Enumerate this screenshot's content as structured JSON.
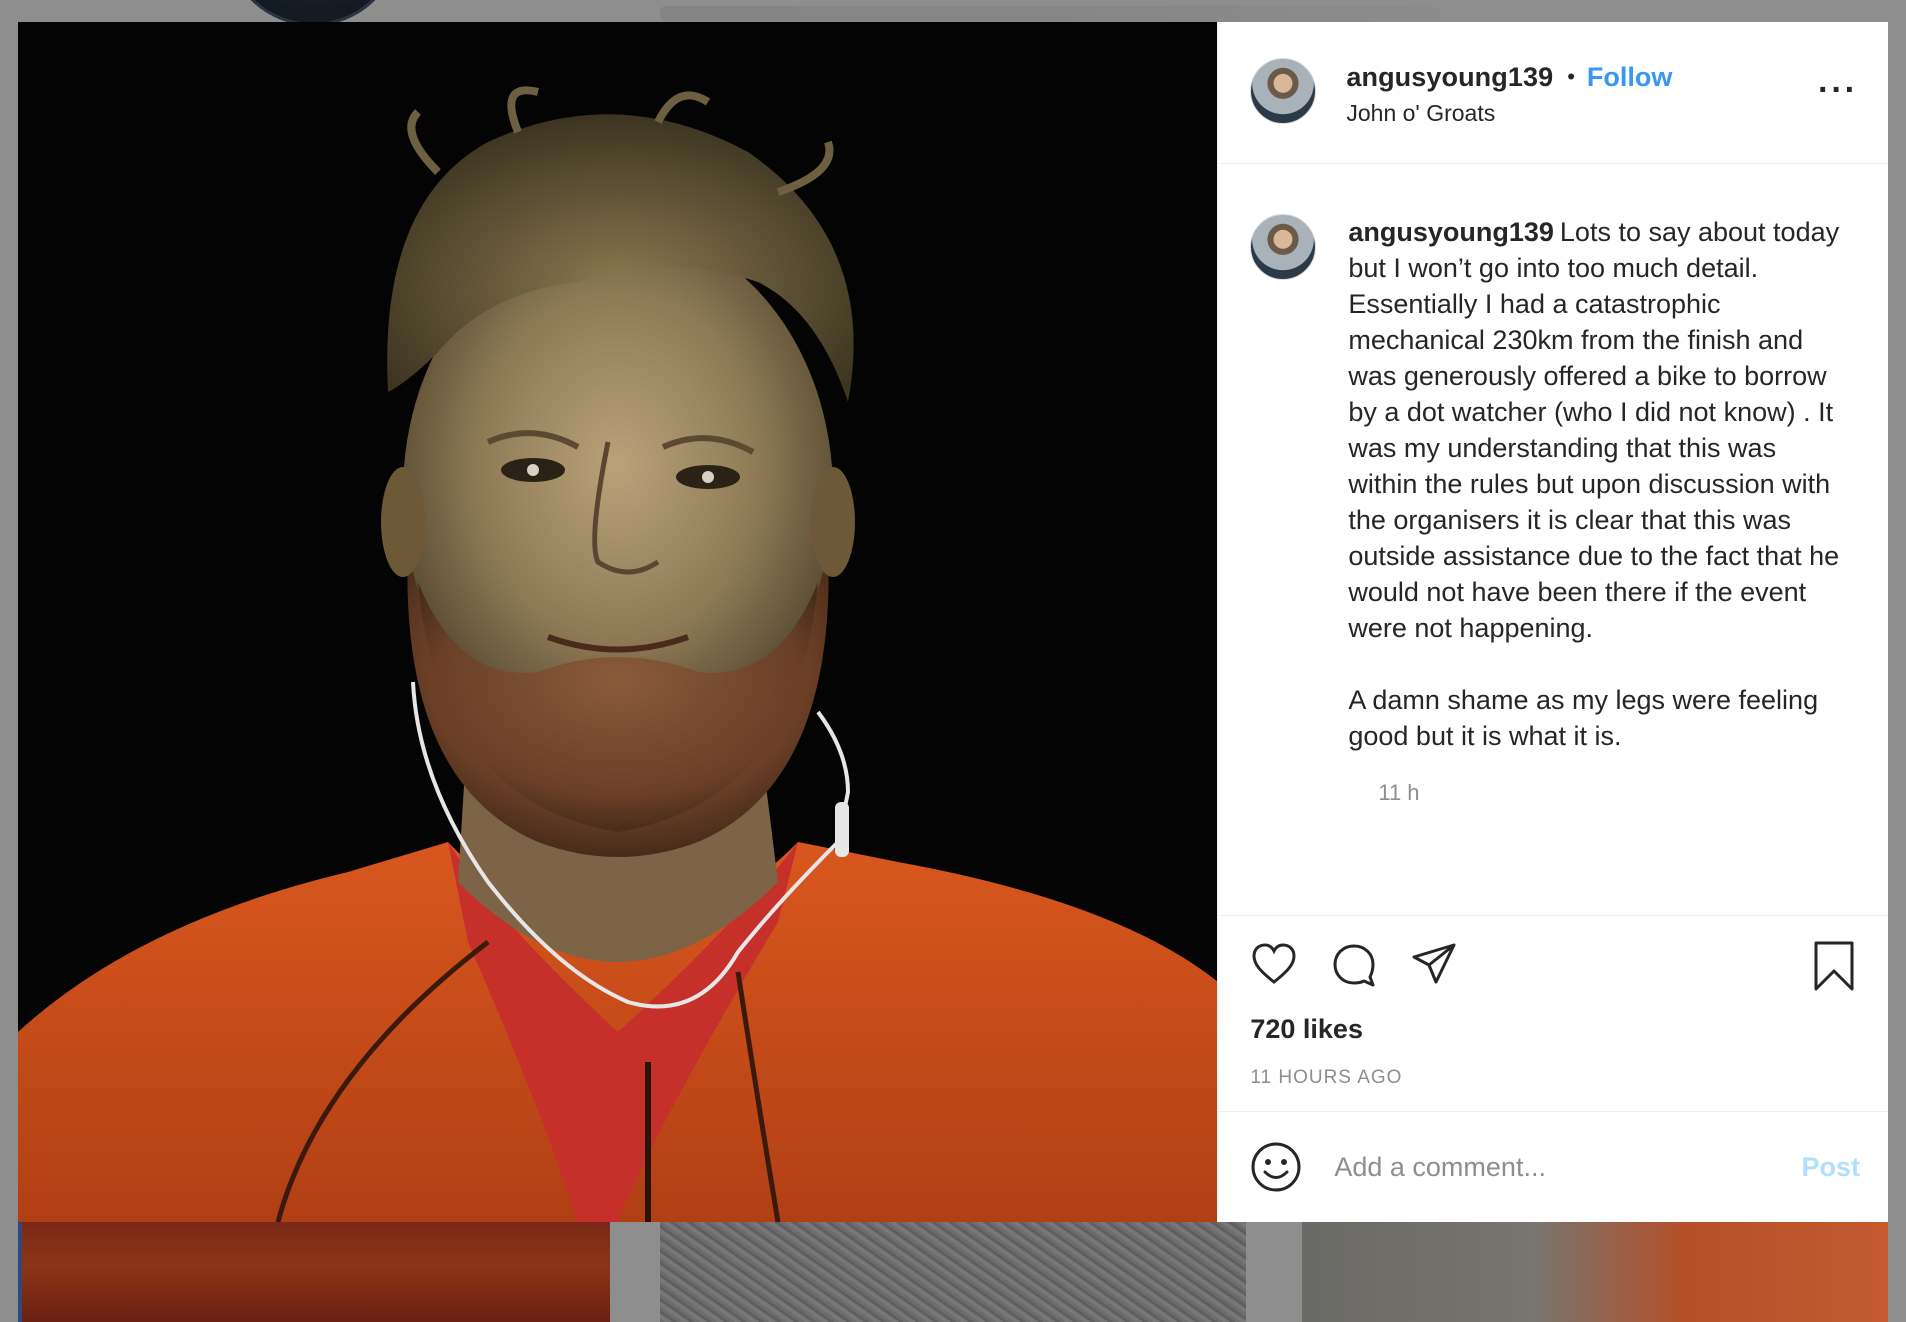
{
  "post": {
    "username": "angusyoung139",
    "follow_label": "Follow",
    "dot": "•",
    "location": "John o' Groats",
    "more_label": "···"
  },
  "caption": {
    "username": "angusyoung139",
    "paragraph1": "Lots to say about today but I won’t go into too much detail. Essentially I had a catastrophic mechanical 230km from the finish and was generously offered a bike to borrow by a dot watcher (who I did not know) . It was my understanding that this was within the rules but upon discussion with the organisers it is clear that this was outside assistance due to the fact that he would not have been there if the event were not happening.",
    "paragraph2": "A damn shame as my legs were feeling good but it is what it is.",
    "time_ago": "11 h"
  },
  "actions": {
    "icons": [
      "heart-icon",
      "comment-icon",
      "share-icon",
      "bookmark-icon"
    ],
    "likes": "720 likes",
    "timestamp": "11 HOURS AGO"
  },
  "comment_box": {
    "placeholder": "Add a comment...",
    "post_label": "Post",
    "icon": "smiley-icon"
  },
  "colors": {
    "accent": "#3897f0",
    "post_disabled": "#b2dffc",
    "text": "#262626",
    "muted": "#8e8e8e"
  }
}
